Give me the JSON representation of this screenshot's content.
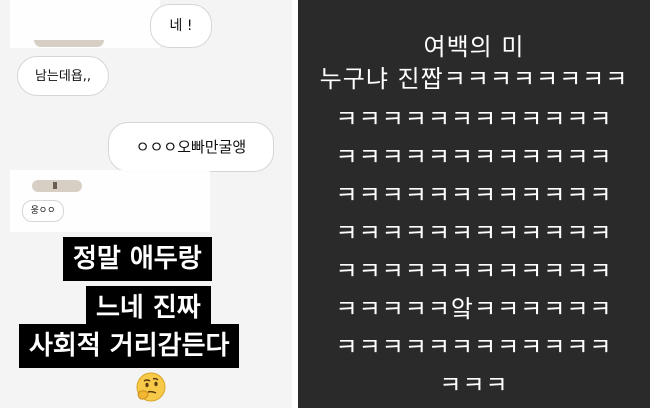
{
  "chat": {
    "bubbles": [
      {
        "text": "네 !"
      },
      {
        "text": "남는데욥,,"
      },
      {
        "text": "ㅇㅇㅇ오빠만굴앵"
      },
      {
        "text": "웅ㅇㅇ"
      }
    ],
    "caption_lines": [
      "정말 애두랑",
      "느네 진짜",
      "사회적 거리감든다"
    ],
    "emoji_icon": "thinking-face-icon"
  },
  "story": {
    "lines": [
      "여백의 미",
      "누구냐 진짭ㅋㅋㅋㅋㅋㅋㅋㅋ",
      "ㅋㅋㅋㅋㅋㅋㅋㅋㅋㅋㅋㅋ",
      "ㅋㅋㅋㅋㅋㅋㅋㅋㅋㅋㅋㅋ",
      "ㅋㅋㅋㅋㅋㅋㅋㅋㅋㅋㅋㅋ",
      "ㅋㅋㅋㅋㅋㅋㅋㅋㅋㅋㅋㅋ",
      "ㅋㅋㅋㅋㅋㅋㅋㅋㅋㅋㅋㅋ",
      "ㅋㅋㅋㅋㅋ앜ㅋㅋㅋㅋㅋㅋ",
      "ㅋㅋㅋㅋㅋㅋㅋㅋㅋㅋㅋㅋ",
      "ㅋㅋㅋ"
    ]
  },
  "colors": {
    "left_background": "#f4f4f4",
    "right_background": "#2a2a2a",
    "caption_background": "#000000",
    "text_light": "#ffffff"
  }
}
